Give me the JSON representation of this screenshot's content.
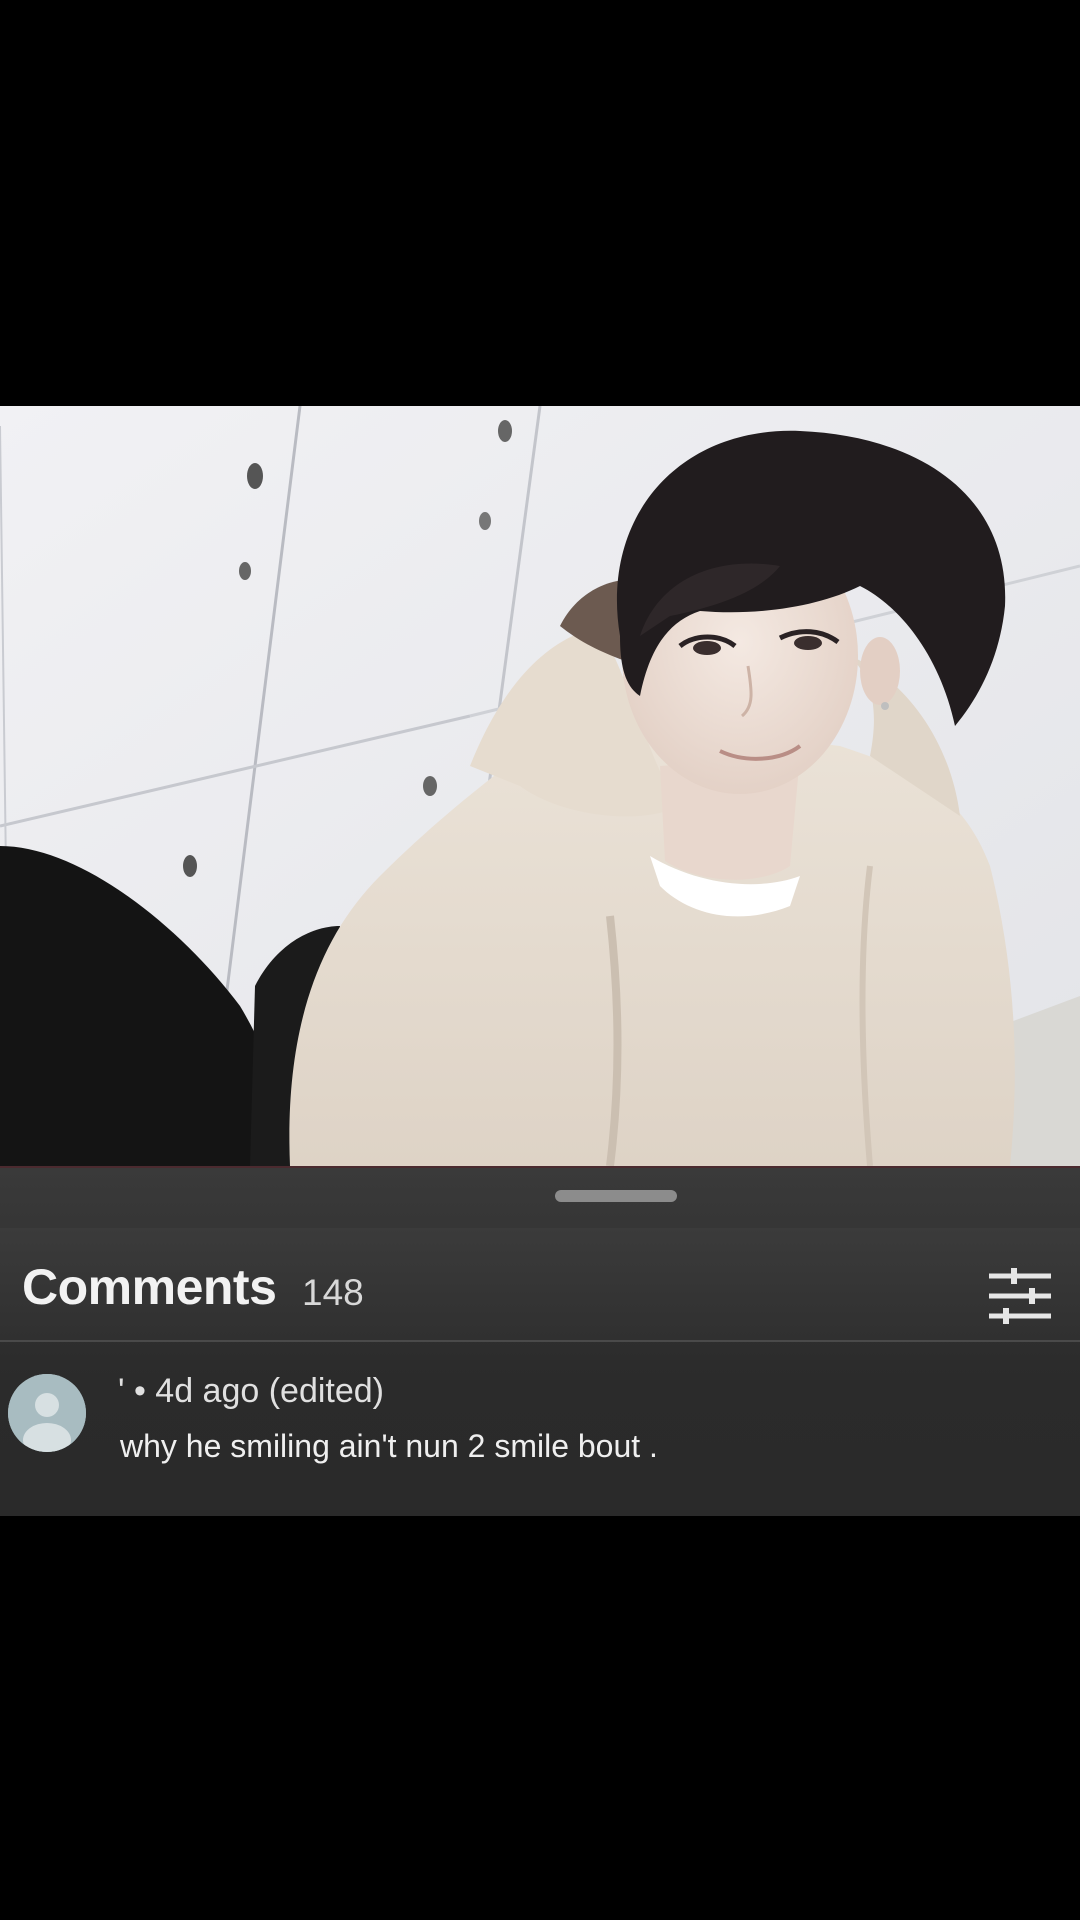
{
  "comments_panel": {
    "title": "Comments",
    "count": "148",
    "filter_icon": "sliders-icon"
  },
  "comment": {
    "meta": "' • 4d ago (edited)",
    "text": "why he smiling ain't nun 2 smile bout ."
  },
  "colors": {
    "sheet_bg": "#2d2d2d",
    "title_text": "#f2f2f2",
    "media_bg": "#e9e9ec"
  }
}
